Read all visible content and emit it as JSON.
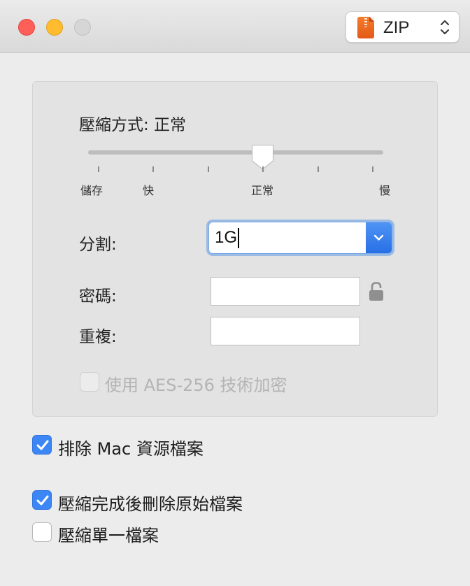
{
  "titlebar": {
    "format": {
      "label": "ZIP",
      "icon": "zip-archive-icon"
    }
  },
  "compression": {
    "label": "壓縮方式: 正常",
    "ticks": [
      "儲存",
      "快",
      "正常",
      "慢"
    ]
  },
  "split": {
    "label": "分割:",
    "value": "1G"
  },
  "password": {
    "label": "密碼:",
    "value": ""
  },
  "repeat": {
    "label": "重複:",
    "value": ""
  },
  "aes": {
    "label": "使用 AES-256 技術加密",
    "checked": false,
    "enabled": false
  },
  "options": {
    "exclude_mac": {
      "label": "排除 Mac 資源檔案",
      "checked": true
    },
    "delete_after": {
      "label": "壓縮完成後刪除原始檔案",
      "checked": true
    },
    "single_file": {
      "label": "壓縮單一檔案",
      "checked": false
    }
  },
  "colors": {
    "accent": "#3c86f5",
    "close": "#fe5f57",
    "minimize": "#febc2e",
    "zoom": "#d6d6d6",
    "zip_icon": "#f0702a"
  }
}
